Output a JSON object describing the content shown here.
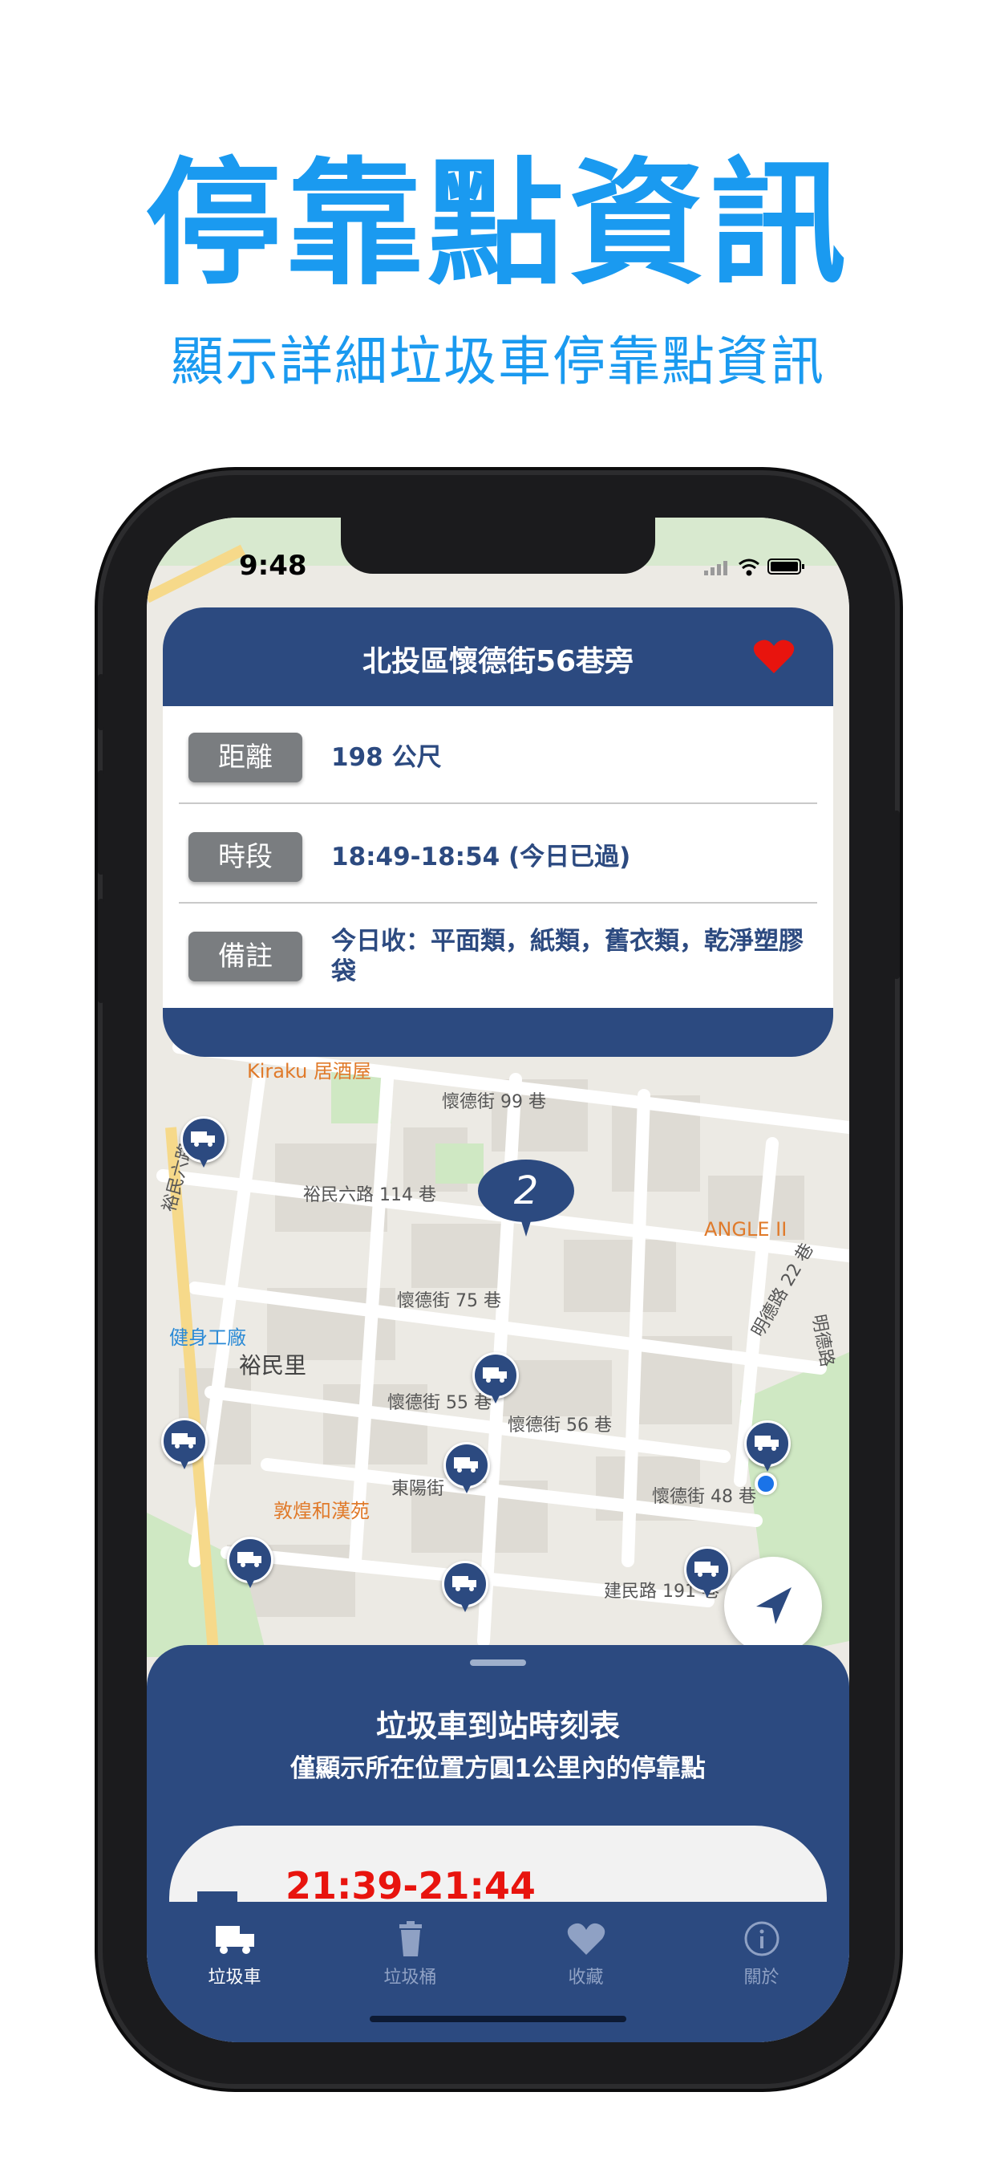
{
  "promo": {
    "headline": "停靠點資訊",
    "subline": "顯示詳細垃圾車停靠點資訊"
  },
  "status_bar": {
    "time": "9:48"
  },
  "stop_card": {
    "title": "北投區懷德街56巷旁",
    "favorite_icon": "heart-icon",
    "favorite_color": "#e8140e",
    "rows": [
      {
        "label": "距離",
        "value": "198 公尺"
      },
      {
        "label": "時段",
        "value": "18:49-18:54 (今日已過)"
      },
      {
        "label": "備註",
        "value": "今日收：平面類，紙類，舊衣類，乾淨塑膠袋"
      }
    ]
  },
  "map": {
    "cluster_count": "2",
    "labels": {
      "street_1": "懷德街 99 巷",
      "street_2": "裕民六路 114 巷",
      "street_3": "懷德街 75 巷",
      "street_4": "懷德街 55 巷",
      "street_5": "懷德街 56 巷",
      "street_6": "東陽街",
      "street_7": "懷德街 48 巷",
      "street_8": "建民路 191 巷",
      "street_9": "裕民六路",
      "street_10": "明德路 22 巷",
      "street_11": "明德路",
      "district": "裕民里",
      "poi_1": "Kiraku 居酒屋",
      "poi_2": "ANGLE II",
      "poi_3": "健身工廠",
      "poi_4": "敦煌和漢苑"
    }
  },
  "schedule_sheet": {
    "title": "垃圾車到站時刻表",
    "subtitle": "僅顯示所在位置方圓1公里內的停靠點",
    "first_item_time": "21:39-21:44"
  },
  "tabs": [
    {
      "label": "垃圾車",
      "icon": "garbage-truck-icon",
      "active": true
    },
    {
      "label": "垃圾桶",
      "icon": "trash-can-icon",
      "active": false
    },
    {
      "label": "收藏",
      "icon": "heart-icon",
      "active": false
    },
    {
      "label": "關於",
      "icon": "info-icon",
      "active": false
    }
  ],
  "colors": {
    "brand_blue": "#2c4a80",
    "headline_blue": "#1a9af0",
    "time_red": "#e8140e"
  }
}
